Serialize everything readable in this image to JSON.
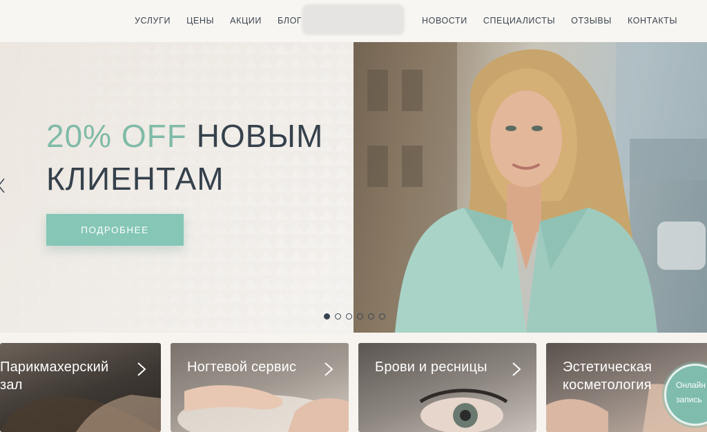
{
  "nav": {
    "left": [
      "УСЛУГИ",
      "ЦЕНЫ",
      "АКЦИИ",
      "БЛОГ"
    ],
    "right": [
      "НОВОСТИ",
      "СПЕЦИАЛИСТЫ",
      "ОТЗЫВЫ",
      "КОНТАКТЫ"
    ]
  },
  "hero": {
    "title_accent": "20% OFF",
    "title_rest": "НОВЫМ",
    "title_line2": "КЛИЕНТАМ",
    "button_label": "ПОДРОБНЕЕ",
    "slide_count": 6,
    "active_slide": 0
  },
  "cards": [
    {
      "title": "Парикмахерский\nзал"
    },
    {
      "title": "Ногтевой сервис"
    },
    {
      "title": "Брови и ресницы"
    },
    {
      "title": "Эстетическая\nкосметология"
    }
  ],
  "online_booking": {
    "line1": "Онлайн",
    "line2": "запись"
  },
  "colors": {
    "accent": "#7fbba8",
    "button": "#85c6b6",
    "text_dark": "#35414c",
    "background": "#f7f4f0"
  },
  "icons": [
    "chevron-right-icon",
    "chevron-left-icon"
  ]
}
